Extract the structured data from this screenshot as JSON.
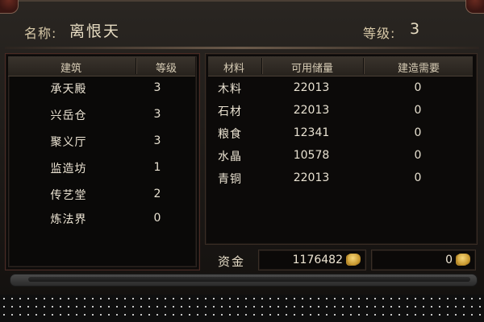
{
  "header": {
    "name_label": "名称:",
    "name_value": "离恨天",
    "level_label": "等级:",
    "level_value": "3"
  },
  "buildings": {
    "columns": [
      "建筑",
      "等级"
    ],
    "rows": [
      {
        "name": "承天殿",
        "level": "3"
      },
      {
        "name": "兴岳仓",
        "level": "3"
      },
      {
        "name": "聚义厅",
        "level": "3"
      },
      {
        "name": "监造坊",
        "level": "1"
      },
      {
        "name": "传艺堂",
        "level": "2"
      },
      {
        "name": "炼法界",
        "level": "0"
      }
    ]
  },
  "materials": {
    "columns": [
      "材料",
      "可用储量",
      "建造需要"
    ],
    "rows": [
      {
        "name": "木料",
        "available": "22013",
        "required": "0"
      },
      {
        "name": "石材",
        "available": "22013",
        "required": "0"
      },
      {
        "name": "粮食",
        "available": "12341",
        "required": "0"
      },
      {
        "name": "水晶",
        "available": "10578",
        "required": "0"
      },
      {
        "name": "青铜",
        "available": "22013",
        "required": "0"
      }
    ]
  },
  "funds": {
    "label": "资金",
    "available": "1176482",
    "required": "0",
    "currency_icon": "gold-coin-icon"
  },
  "colors": {
    "text": "#e9e2d2",
    "header_bg": "#2e2924",
    "panel_bg": "#0c0a09",
    "accent_red": "#4a2a24"
  }
}
